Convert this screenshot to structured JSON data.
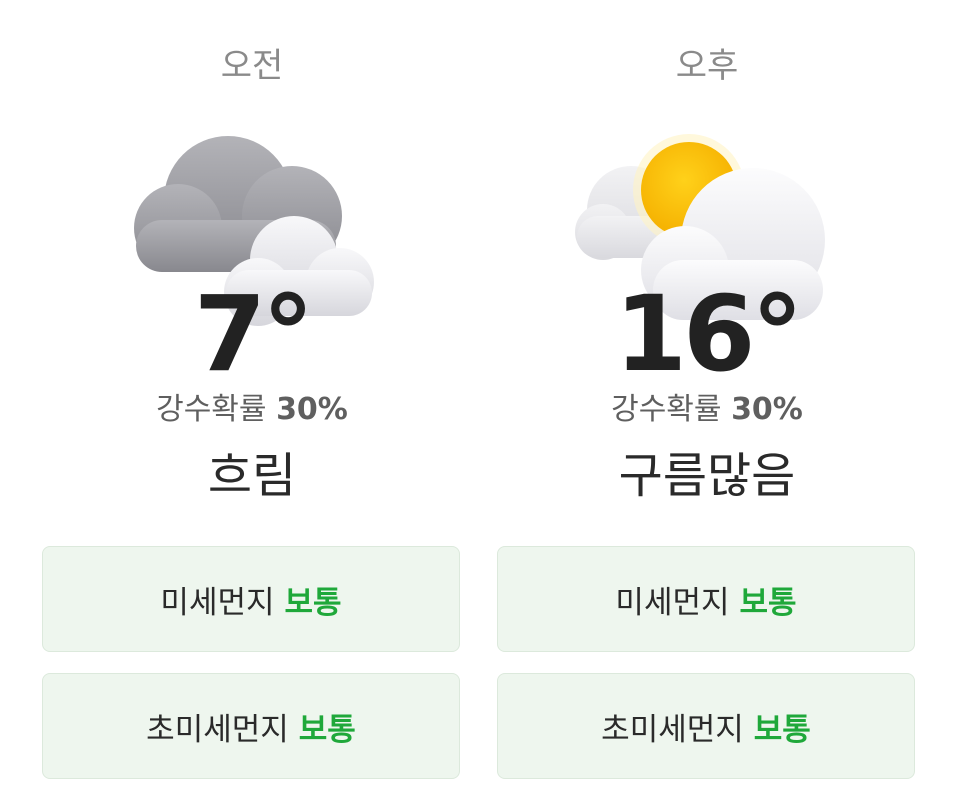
{
  "forecast": {
    "morning": {
      "period": "오전",
      "icon": "cloudy-icon",
      "temperature": "7°",
      "precip_label": "강수확률",
      "precip_value": "30%",
      "condition": "흐림",
      "fine_dust": {
        "label": "미세먼지",
        "status": "보통"
      },
      "ultrafine_dust": {
        "label": "초미세먼지",
        "status": "보통"
      }
    },
    "afternoon": {
      "period": "오후",
      "icon": "partly-cloudy-sun-icon",
      "temperature": "16°",
      "precip_label": "강수확률",
      "precip_value": "30%",
      "condition": "구름많음",
      "fine_dust": {
        "label": "미세먼지",
        "status": "보통"
      },
      "ultrafine_dust": {
        "label": "초미세먼지",
        "status": "보통"
      }
    }
  },
  "colors": {
    "status_good": "#1fa83a",
    "card_background": "#eef6ee",
    "sun": "#f5b800"
  }
}
